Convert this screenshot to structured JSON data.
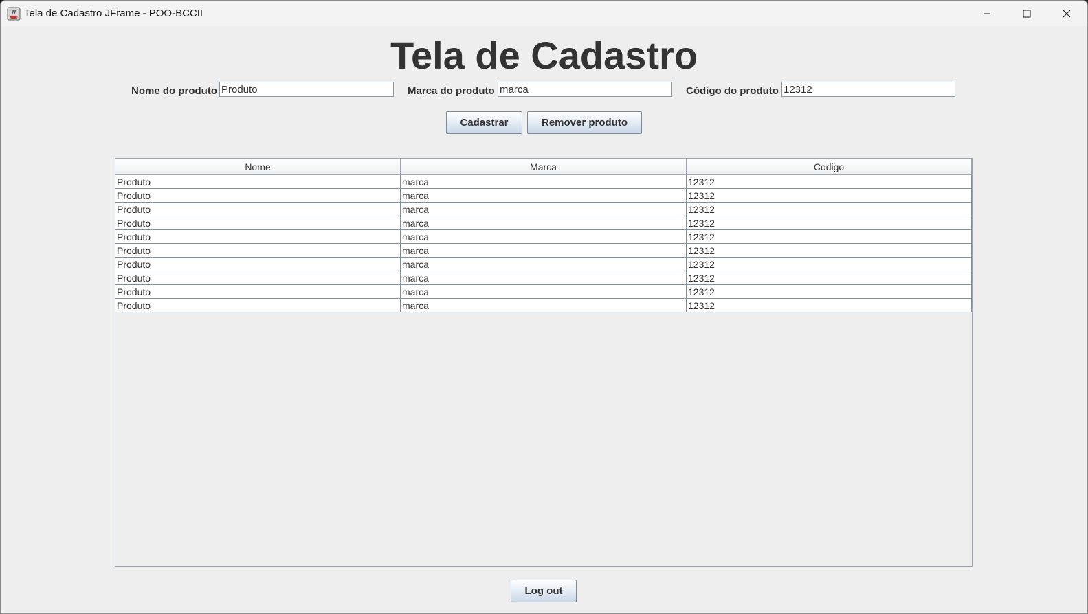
{
  "window": {
    "title": "Tela de Cadastro JFrame - POO-BCCII"
  },
  "page": {
    "heading": "Tela de Cadastro"
  },
  "form": {
    "nome_label": "Nome do produto",
    "nome_value": "Produto",
    "marca_label": "Marca do produto",
    "marca_value": "marca",
    "codigo_label": "Código do produto",
    "codigo_value": "12312"
  },
  "actions": {
    "cadastrar_label": "Cadastrar",
    "remover_label": "Remover produto",
    "logout_label": "Log out"
  },
  "table": {
    "columns": [
      "Nome",
      "Marca",
      "Codigo"
    ],
    "rows": [
      [
        "Produto",
        "marca",
        "12312"
      ],
      [
        "Produto",
        "marca",
        "12312"
      ],
      [
        "Produto",
        "marca",
        "12312"
      ],
      [
        "Produto",
        "marca",
        "12312"
      ],
      [
        "Produto",
        "marca",
        "12312"
      ],
      [
        "Produto",
        "marca",
        "12312"
      ],
      [
        "Produto",
        "marca",
        "12312"
      ],
      [
        "Produto",
        "marca",
        "12312"
      ],
      [
        "Produto",
        "marca",
        "12312"
      ],
      [
        "Produto",
        "marca",
        "12312"
      ]
    ]
  },
  "icons": {
    "app": "java-cup-icon",
    "minimize": "minimize-icon",
    "maximize": "maximize-icon",
    "close": "close-icon"
  }
}
